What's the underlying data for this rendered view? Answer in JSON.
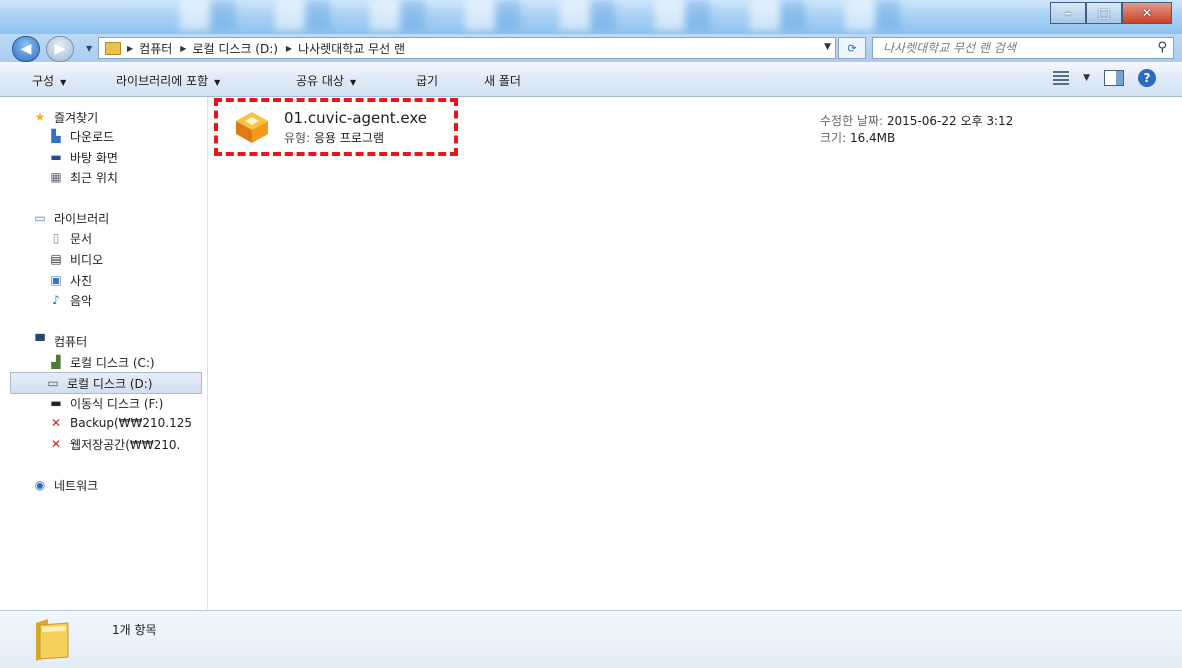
{
  "window": {
    "controls": {
      "minimize": "–",
      "maximize": "□",
      "close": "✕"
    }
  },
  "address_bar": {
    "crumbs": [
      "컴퓨터",
      "로컬 디스크 (D:)",
      "나사렛대학교 무선 랜"
    ],
    "search_placeholder": "나사렛대학교 무선 랜 검색"
  },
  "toolbar": {
    "items": [
      "구성",
      "라이브러리에 포함",
      "공유 대상",
      "굽기",
      "새 폴더"
    ]
  },
  "nav": {
    "favorites": {
      "title": "즐겨찾기",
      "items": [
        "다운로드",
        "바탕 화면",
        "최근 위치"
      ]
    },
    "libraries": {
      "title": "라이브러리",
      "items": [
        "문서",
        "비디오",
        "사진",
        "음악"
      ]
    },
    "computer": {
      "title": "컴퓨터",
      "items": [
        "로컬 디스크 (C:)",
        "로컬 디스크 (D:)",
        "이동식 디스크 (F:)",
        "Backup(₩₩210.125",
        "웹저장공간(₩₩210."
      ]
    },
    "network": {
      "title": "네트워크"
    },
    "selected": "로컬 디스크 (D:)"
  },
  "file": {
    "name": "01.cuvic-agent.exe",
    "type_label": "유형:",
    "type_value": "응용 프로그램",
    "modified_label": "수정한 날짜:",
    "modified_value": "2015-06-22 오후 3:12",
    "size_label": "크기:",
    "size_value": "16.4MB"
  },
  "status": {
    "count_text": "1개 항목"
  },
  "colors": {
    "highlight": "#e8161b",
    "titlebar": "#a9d2f5",
    "toolbar": "#dfeaf7"
  }
}
